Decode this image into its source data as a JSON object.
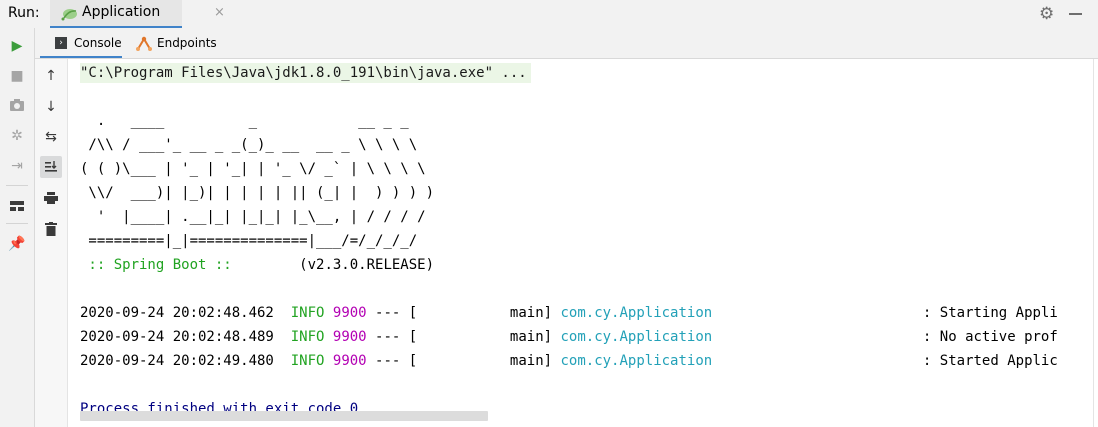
{
  "runbar": {
    "label": "Run:",
    "tab_title": "Application",
    "close_glyph": "×",
    "settings_icon": "gear-icon",
    "minimize_icon": "minimize-icon"
  },
  "tool_strip": {
    "items": [
      "rerun-icon",
      "stop-icon",
      "camera-icon",
      "debug-icon",
      "exit-icon",
      "layout-icon",
      "pin-icon"
    ]
  },
  "subtabs": [
    {
      "label": "Console",
      "icon": "console-icon",
      "active": true
    },
    {
      "label": "Endpoints",
      "icon": "endpoints-icon",
      "active": false
    }
  ],
  "console": {
    "command": "\"C:\\Program Files\\Java\\jdk1.8.0_191\\bin\\java.exe\" ...",
    "banner": [
      "  .   ____          _            __ _ _",
      " /\\\\ / ___'_ __ _ _(_)_ __  __ _ \\ \\ \\ \\",
      "( ( )\\___ | '_ | '_| | '_ \\/ _` | \\ \\ \\ \\",
      " \\\\/  ___)| |_)| | | | | || (_| |  ) ) ) )",
      "  '  |____| .__|_| |_|_| |_\\__, | / / / /",
      " =========|_|==============|___/=/_/_/_/"
    ],
    "spring_boot_label": " :: Spring Boot :: ",
    "spring_boot_version": "       (v2.3.0.RELEASE)",
    "logs": [
      {
        "timestamp": "2020-09-24 20:02:48.462",
        "level": "INFO",
        "pid": "9900",
        "sep": " --- [",
        "thread": "           main] ",
        "logger": "com.cy.Application",
        "message": "                         : Starting Appli"
      },
      {
        "timestamp": "2020-09-24 20:02:48.489",
        "level": "INFO",
        "pid": "9900",
        "sep": " --- [",
        "thread": "           main] ",
        "logger": "com.cy.Application",
        "message": "                         : No active prof"
      },
      {
        "timestamp": "2020-09-24 20:02:49.480",
        "level": "INFO",
        "pid": "9900",
        "sep": " --- [",
        "thread": "           main] ",
        "logger": "com.cy.Application",
        "message": "                         : Started Applic"
      }
    ],
    "exit_message": "Process finished with exit code 0"
  },
  "colors": {
    "accent": "#4083c9",
    "info_green": "#21a321",
    "pid_magenta": "#b300b3",
    "logger_cyan": "#23a1b8",
    "exit_navy": "#000080"
  }
}
